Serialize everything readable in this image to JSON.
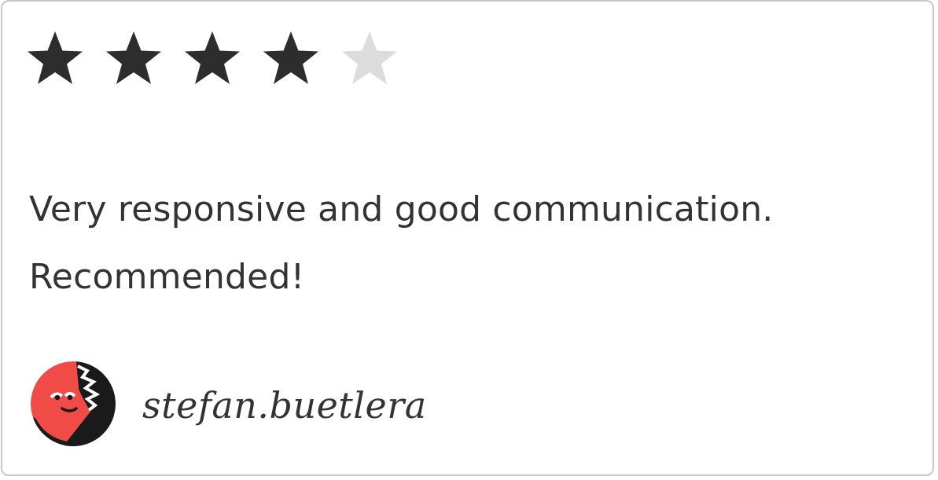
{
  "review": {
    "rating": 4,
    "max_rating": 5,
    "text": "Very responsive and good communication. Recommended!",
    "reviewer_name": "stefan.buetlera"
  },
  "colors": {
    "star_filled": "#2d2d2d",
    "star_empty": "#dcdcdc",
    "text": "#333333",
    "border": "#c7c7c7",
    "avatar_red": "#f04b46",
    "avatar_dark": "#1a1a1a"
  },
  "icons": {
    "star": "star-icon",
    "avatar": "avatar-illustration"
  }
}
